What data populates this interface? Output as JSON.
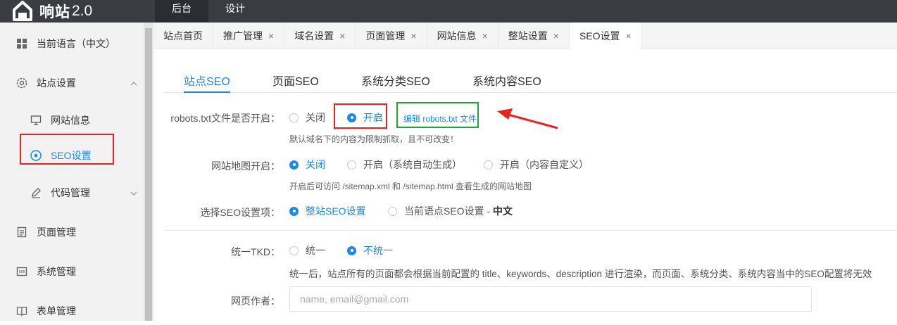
{
  "app": {
    "name": "响站",
    "version": "2.0"
  },
  "topnav": [
    {
      "label": "后台",
      "active": true
    },
    {
      "label": "设计",
      "active": false
    }
  ],
  "sidebar": {
    "items": [
      {
        "label": "当前语言（中文）",
        "icon": "grid-icon"
      },
      {
        "label": "站点设置",
        "icon": "gear-icon",
        "expanded": true
      },
      {
        "label": "网站信息",
        "icon": "monitor-icon"
      },
      {
        "label": "SEO设置",
        "icon": "target-icon",
        "active": true
      },
      {
        "label": "代码管理",
        "icon": "pen-icon"
      },
      {
        "label": "页面管理",
        "icon": "document-icon"
      },
      {
        "label": "系统管理",
        "icon": "system-icon"
      },
      {
        "label": "表单管理",
        "icon": "book-icon"
      }
    ]
  },
  "tabs": [
    {
      "label": "站点首页",
      "closable": false
    },
    {
      "label": "推广管理",
      "closable": true
    },
    {
      "label": "域名设置",
      "closable": true
    },
    {
      "label": "页面管理",
      "closable": true
    },
    {
      "label": "网站信息",
      "closable": true
    },
    {
      "label": "整站设置",
      "closable": true
    },
    {
      "label": "SEO设置",
      "closable": true,
      "active": true
    }
  ],
  "close_glyph": "×",
  "subtabs": [
    {
      "label": "站点SEO",
      "active": true
    },
    {
      "label": "页面SEO"
    },
    {
      "label": "系统分类SEO"
    },
    {
      "label": "系统内容SEO"
    }
  ],
  "form": {
    "robots": {
      "label": "robots.txt文件是否开启：",
      "options": [
        "关闭",
        "开启"
      ],
      "selected": "开启",
      "edit_link": "编辑 robots.txt 文件",
      "hint": "默认域名下的内容为限制抓取，且不可改变！"
    },
    "sitemap": {
      "label": "网站地图开启：",
      "options": [
        "关闭",
        "开启（系统自动生成）",
        "开启（内容自定义）"
      ],
      "selected": "关闭",
      "hint": "开启后可访问 /sitemap.xml 和 /sitemap.html 查看生成的网站地图"
    },
    "seo_scope": {
      "label": "选择SEO设置项：",
      "option_site": "整站SEO设置",
      "option_lang_prefix": "当前语点SEO设置 - ",
      "option_lang_bold": "中文",
      "selected": "整站SEO设置"
    },
    "tkd": {
      "label": "统一TKD：",
      "options": [
        "统一",
        "不统一"
      ],
      "selected": "不统一",
      "hint": "统一后，站点所有的页面都会根据当前配置的 title、keywords、description 进行渲染，而页面、系统分类、系统内容当中的SEO配置将无效"
    },
    "author": {
      "label": "网页作者：",
      "placeholder": "name, email@gmail.com",
      "value": ""
    }
  },
  "colors": {
    "accent": "#1e88e5",
    "topbar": "#393d42",
    "highlight_red": "#e6231e",
    "highlight_green": "#22a339"
  }
}
